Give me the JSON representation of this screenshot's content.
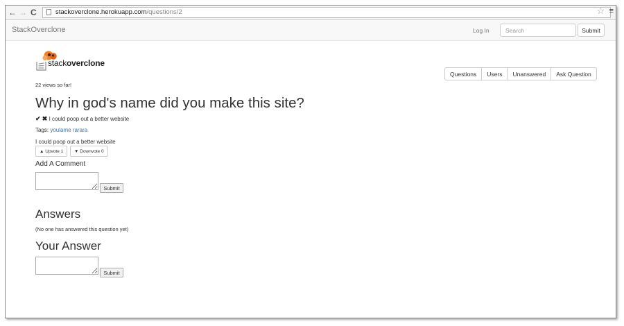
{
  "browser": {
    "url_host": "stackoverclone.herokuapp.com",
    "url_path": "/questions/2"
  },
  "navbar": {
    "brand": "StackOverclone",
    "login": "Log In",
    "search_placeholder": "Search",
    "submit": "Submit"
  },
  "logo": {
    "text_plain": "stack",
    "text_bold": "overclone"
  },
  "nav_buttons": [
    "Questions",
    "Users",
    "Unanswered",
    "Ask Question"
  ],
  "question": {
    "views": "22 views so far!",
    "title": "Why in god's name did you make this site?",
    "status_text": "I could poop out a better website",
    "tags_label": "Tags:",
    "tags": "youlame rarara",
    "body": "I could poop out a better website",
    "upvote_label": "Upvote 1",
    "downvote_label": "Downvote 0"
  },
  "comment": {
    "heading": "Add A Comment",
    "submit": "Submit"
  },
  "answers": {
    "heading": "Answers",
    "empty_text": "(No one has answered this question yet)"
  },
  "your_answer": {
    "heading": "Your Answer",
    "submit": "Submit"
  },
  "colors": {
    "tag_link": "#3a75b0",
    "logo_orange": "#f48024"
  },
  "icons": [
    "back-arrow-icon",
    "forward-arrow-icon",
    "reload-icon",
    "page-icon",
    "bookmark-star-icon",
    "chrome-menu-icon",
    "checkmark-icon",
    "cross-icon",
    "caret-up-icon",
    "caret-down-icon",
    "logo-icon"
  ]
}
